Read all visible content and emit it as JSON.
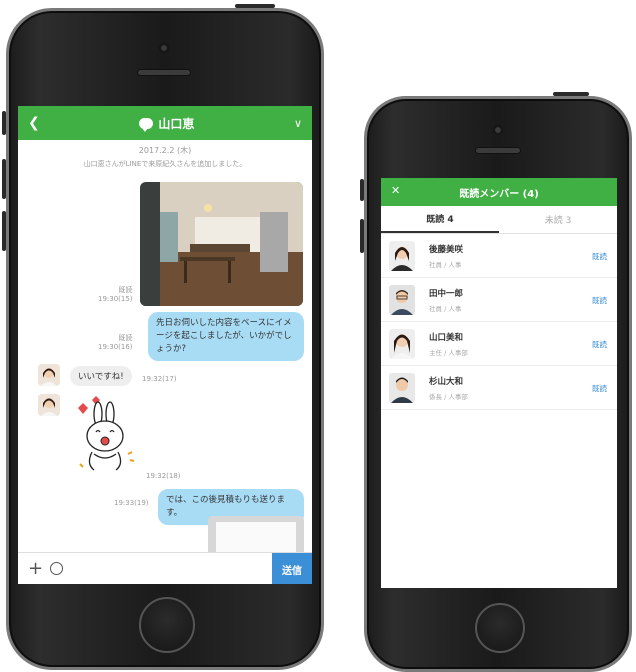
{
  "left_phone": {
    "chat": {
      "title": "山口恵",
      "back_icon": "chevron-left-icon",
      "menu_icon": "chevron-down-icon",
      "date": "2017.2.2 (木)",
      "system_message": "山口恵さんがLINEで来原紀久さんを追加しました。",
      "photo_meta": {
        "read": "既読",
        "time": "19:30(15)"
      },
      "message_out_1": {
        "text": "先日お伺いした内容をベースにイメージを起こしましたが、いかがでしょうか?",
        "read": "既読",
        "time": "19:30(16)"
      },
      "message_in_1": {
        "text": "いいですね!",
        "time": "19:32(17)"
      },
      "sticker_time": "19:32(18)",
      "message_out_2": {
        "text": "では、この後見積もりも送ります。",
        "time": "19:33(19)"
      }
    },
    "input": {
      "plus_icon": "plus-icon",
      "emoji_icon": "emoji-icon",
      "send_label": "送信"
    }
  },
  "right_phone": {
    "title": "既読メンバー (4)",
    "close_icon": "close-icon",
    "tabs": [
      {
        "label": "既読 4",
        "active": true
      },
      {
        "label": "未読 3",
        "active": false
      }
    ],
    "members": [
      {
        "name": "後藤美咲",
        "role": "社員 / 人事",
        "status": "既読"
      },
      {
        "name": "田中一郎",
        "role": "社員 / 人事",
        "status": "既読"
      },
      {
        "name": "山口美和",
        "role": "主任 / 人事部",
        "status": "既読"
      },
      {
        "name": "杉山大和",
        "role": "係長 / 人事部",
        "status": "既読"
      }
    ]
  },
  "colors": {
    "brand_green": "#41b044",
    "bubble_blue": "#a8dcf5",
    "send_blue": "#3a8fd6"
  }
}
